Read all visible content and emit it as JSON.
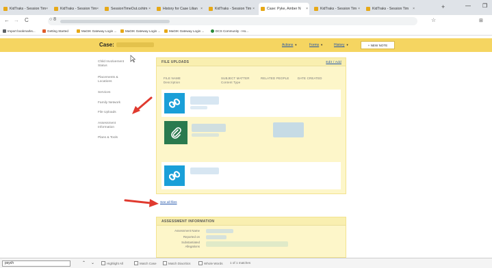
{
  "tabs": [
    {
      "label": "KidTraks - Session Tim",
      "close": "×"
    },
    {
      "label": "KidTraks - Session Tim",
      "close": "×"
    },
    {
      "label": "SessionTimeOut.cshtm",
      "close": "×"
    },
    {
      "label": "History for Case Lilian",
      "close": "×"
    },
    {
      "label": "KidTraks - Session Tim",
      "close": "×"
    },
    {
      "label": "Case: Pyke, Amber N",
      "close": "×"
    },
    {
      "label": "KidTraks - Session Tim",
      "close": "×"
    },
    {
      "label": "KidTraks - Session Tim",
      "close": "×"
    }
  ],
  "browser": {
    "new_tab": "+",
    "minimize": "—",
    "maximize": "❐",
    "back": "←",
    "forward": "→",
    "reload": "C",
    "lock_icon": "○ 8",
    "bookmark_star": "☆",
    "extensions": "⊞"
  },
  "bookmarks": [
    {
      "label": "Import bookmarks...",
      "icon": "import-icon",
      "color": "#5f6368"
    },
    {
      "label": "Getting Started",
      "icon": "firefox-icon",
      "color": "#e05c2a"
    },
    {
      "label": "MaGIK Gateway Login ...",
      "icon": "kidtraks-icon",
      "color": "#e6a817"
    },
    {
      "label": "MaGIK Gateway Login ...",
      "icon": "kidtraks-icon",
      "color": "#e6a817"
    },
    {
      "label": "MaGIK Gateway Login ...",
      "icon": "kidtraks-icon",
      "color": "#e6a817"
    },
    {
      "label": "DCS Community - Ho...",
      "icon": "dcs-icon",
      "color": "#2a8a3a"
    }
  ],
  "header": {
    "case_label": "Case:",
    "menus": [
      {
        "label": "Actions"
      },
      {
        "label": "Forms"
      },
      {
        "label": "History"
      }
    ],
    "new_note": "+ NEW NOTE"
  },
  "sidebar": {
    "items": [
      {
        "label": "Child Involvement\nStatus"
      },
      {
        "label": "Placements &\nLocations"
      },
      {
        "label": "Services"
      },
      {
        "label": "Family Network"
      },
      {
        "label": "File Uploads"
      },
      {
        "label": "Assessment\nInformation"
      },
      {
        "label": "Plans & Tools"
      }
    ]
  },
  "file_uploads": {
    "title": "FILE UPLOADS",
    "edit_add": "Edit / Add",
    "columns": [
      {
        "label": "FILE NAME\nDescription"
      },
      {
        "label": "SUBJECT MATTER\nContent Type"
      },
      {
        "label": "RELATED PEOPLE"
      },
      {
        "label": "DATE CREATED"
      }
    ],
    "rows": [
      {
        "icon": "link-icon"
      },
      {
        "icon": "paperclip-icon"
      },
      {
        "icon": "link-icon"
      }
    ],
    "see_all": "See all files"
  },
  "assessment": {
    "title": "ASSESSMENT INFORMATION",
    "fields": [
      {
        "label": "Assessment Name"
      },
      {
        "label": "Reported on"
      },
      {
        "label": "Substantiated\nAllegations"
      }
    ]
  },
  "find_bar": {
    "query": "psych",
    "up": "⌃",
    "down": "⌄",
    "options": [
      {
        "label": "Highlight All"
      },
      {
        "label": "Match Case"
      },
      {
        "label": "Match Diacritics"
      },
      {
        "label": "Whole Words"
      }
    ],
    "result": "1 of 1 matches"
  },
  "colors": {
    "header_yellow": "#f5d561",
    "panel_yellow": "#fdf6c9",
    "link_blue": "#1a9fd8",
    "clip_green": "#2a7a4e",
    "arrow_red": "#e03a2f"
  }
}
